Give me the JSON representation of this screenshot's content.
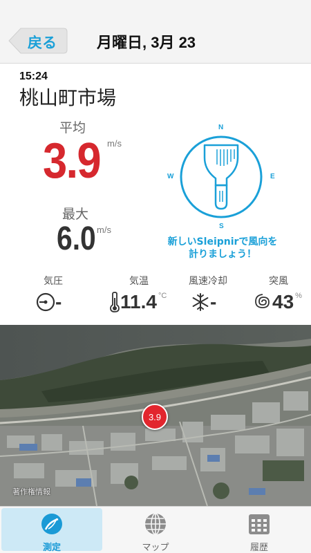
{
  "header": {
    "back_label": "戻る",
    "title": "月曜日, 3月 23"
  },
  "measurement": {
    "time": "15:24",
    "location": "桃山町市場",
    "average_label": "平均",
    "average_value": "3.9",
    "average_unit": "m/s",
    "max_label": "最大",
    "max_value": "6.0",
    "max_unit": "m/s"
  },
  "compass": {
    "n": "N",
    "e": "E",
    "s": "S",
    "w": "W",
    "message_line1": "新しいSleipnirで風向を",
    "message_line2": "計りましょう！",
    "accent_color": "#1aa0d8"
  },
  "stats": {
    "pressure_label": "気圧",
    "pressure_value": "-",
    "temperature_label": "気温",
    "temperature_value": "11.4",
    "temperature_unit": "°C",
    "windchill_label": "風速冷却",
    "windchill_value": "-",
    "humidity_label": "突風",
    "humidity_value": "43",
    "humidity_unit": "%"
  },
  "map": {
    "pin_value": "3.9",
    "credit": "著作権情報"
  },
  "tabs": {
    "measure_label": "測定",
    "map_label": "マップ",
    "history_label": "履歴"
  },
  "colors": {
    "average": "#d6282e",
    "tab_active": "#1a9ad6"
  }
}
